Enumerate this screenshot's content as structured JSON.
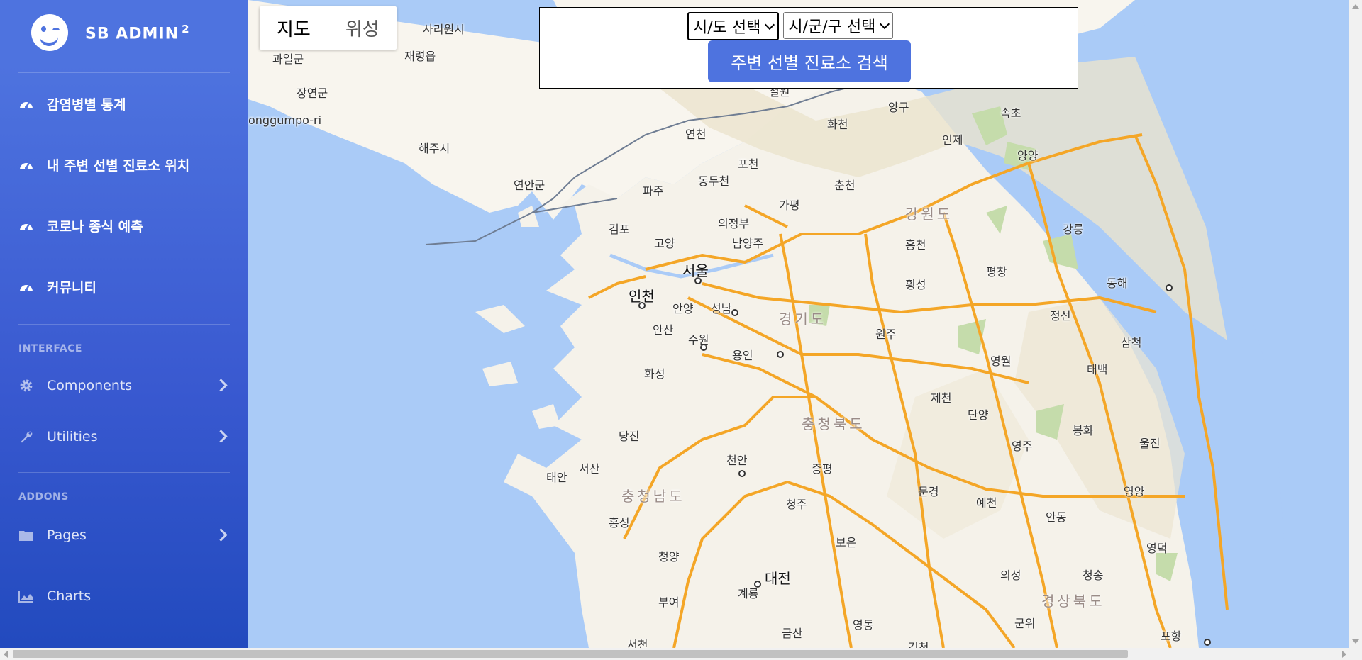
{
  "brand": {
    "name": "SB ADMIN",
    "sup": "2"
  },
  "sidebar": {
    "items": [
      {
        "label": "감염병별 통계",
        "icon": "gauge-icon"
      },
      {
        "label": "내 주변 선별 진료소 위치",
        "icon": "gauge-icon"
      },
      {
        "label": "코로나 종식 예측",
        "icon": "gauge-icon"
      },
      {
        "label": "커뮤니티",
        "icon": "gauge-icon"
      }
    ],
    "interface_heading": "INTERFACE",
    "interface_items": [
      {
        "label": "Components",
        "icon": "gear-icon"
      },
      {
        "label": "Utilities",
        "icon": "wrench-icon"
      }
    ],
    "addons_heading": "ADDONS",
    "addons_items": [
      {
        "label": "Pages",
        "icon": "folder-icon"
      },
      {
        "label": "Charts",
        "icon": "chart-area-icon"
      }
    ]
  },
  "map_type": {
    "map": "지도",
    "satellite": "위성"
  },
  "search": {
    "sido_select": "시/도 선택",
    "sigungu_select": "시/군/구 선택",
    "button": "주변 선별 진료소 검색"
  },
  "map_labels": {
    "sariwon": "사리원시",
    "gwail": "과일군",
    "jaeryeong": "재령읍",
    "jangyeon": "장연군",
    "ongjin": "onggumpo-ri",
    "haeju": "해주시",
    "yeonan": "연안군",
    "yeoncheon": "연천",
    "cheorwon": "철원",
    "hwacheon": "화천",
    "yanggu": "양구",
    "sokcho": "속초",
    "inje": "인제",
    "yangyang": "양양",
    "pocheon": "포천",
    "dongducheon": "동두천",
    "paju": "파주",
    "chuncheon": "춘천",
    "gapyeong": "가평",
    "gangwon": "강원도",
    "uijeongbu": "의정부",
    "gimpo": "김포",
    "goyang": "고양",
    "namyangju": "남양주",
    "hongcheon": "홍천",
    "gangneung": "강릉",
    "seoul": "서울",
    "pyeongchang": "평창",
    "donghae": "동해",
    "hoengseong": "횡성",
    "incheon": "인천",
    "anyang": "안양",
    "seongnam": "성남",
    "gyeonggi": "경기도",
    "jeongseon": "정선",
    "ansan": "안산",
    "suwon": "수원",
    "wonju": "원주",
    "samcheok": "삼척",
    "yongin": "용인",
    "yeongwol": "영월",
    "taebaek": "태백",
    "hwaseong": "화성",
    "jecheon": "제천",
    "danyang": "단양",
    "chungbuk": "충청북도",
    "bonghwa": "봉화",
    "dangjin": "당진",
    "yeongju": "영주",
    "uljin": "울진",
    "seosan": "서산",
    "taean": "태안",
    "cheonan": "천안",
    "jeungpyeong": "증평",
    "chungnam": "충청남도",
    "mungyeong": "문경",
    "yeongyang": "영양",
    "cheongju": "청주",
    "yecheon": "예천",
    "hongseong": "홍성",
    "andong": "안동",
    "boeun": "보은",
    "yeongdeok": "영덕",
    "cheongyang": "청양",
    "daejeon": "대전",
    "uiseong": "의성",
    "cheongsong": "청송",
    "gyeryong": "계룡",
    "gyeongbuk": "경상북도",
    "buyeo": "부여",
    "gunwi": "군위",
    "geumsan": "금산",
    "yeongdong": "영동",
    "pohang": "포항",
    "seocheon": "서천",
    "gimcheon": "김천"
  },
  "colors": {
    "sidebar": "#4e73df",
    "button": "#4e73df",
    "sea": "#aacbf7",
    "land": "#f5f3ee",
    "road": "#f4a627"
  }
}
